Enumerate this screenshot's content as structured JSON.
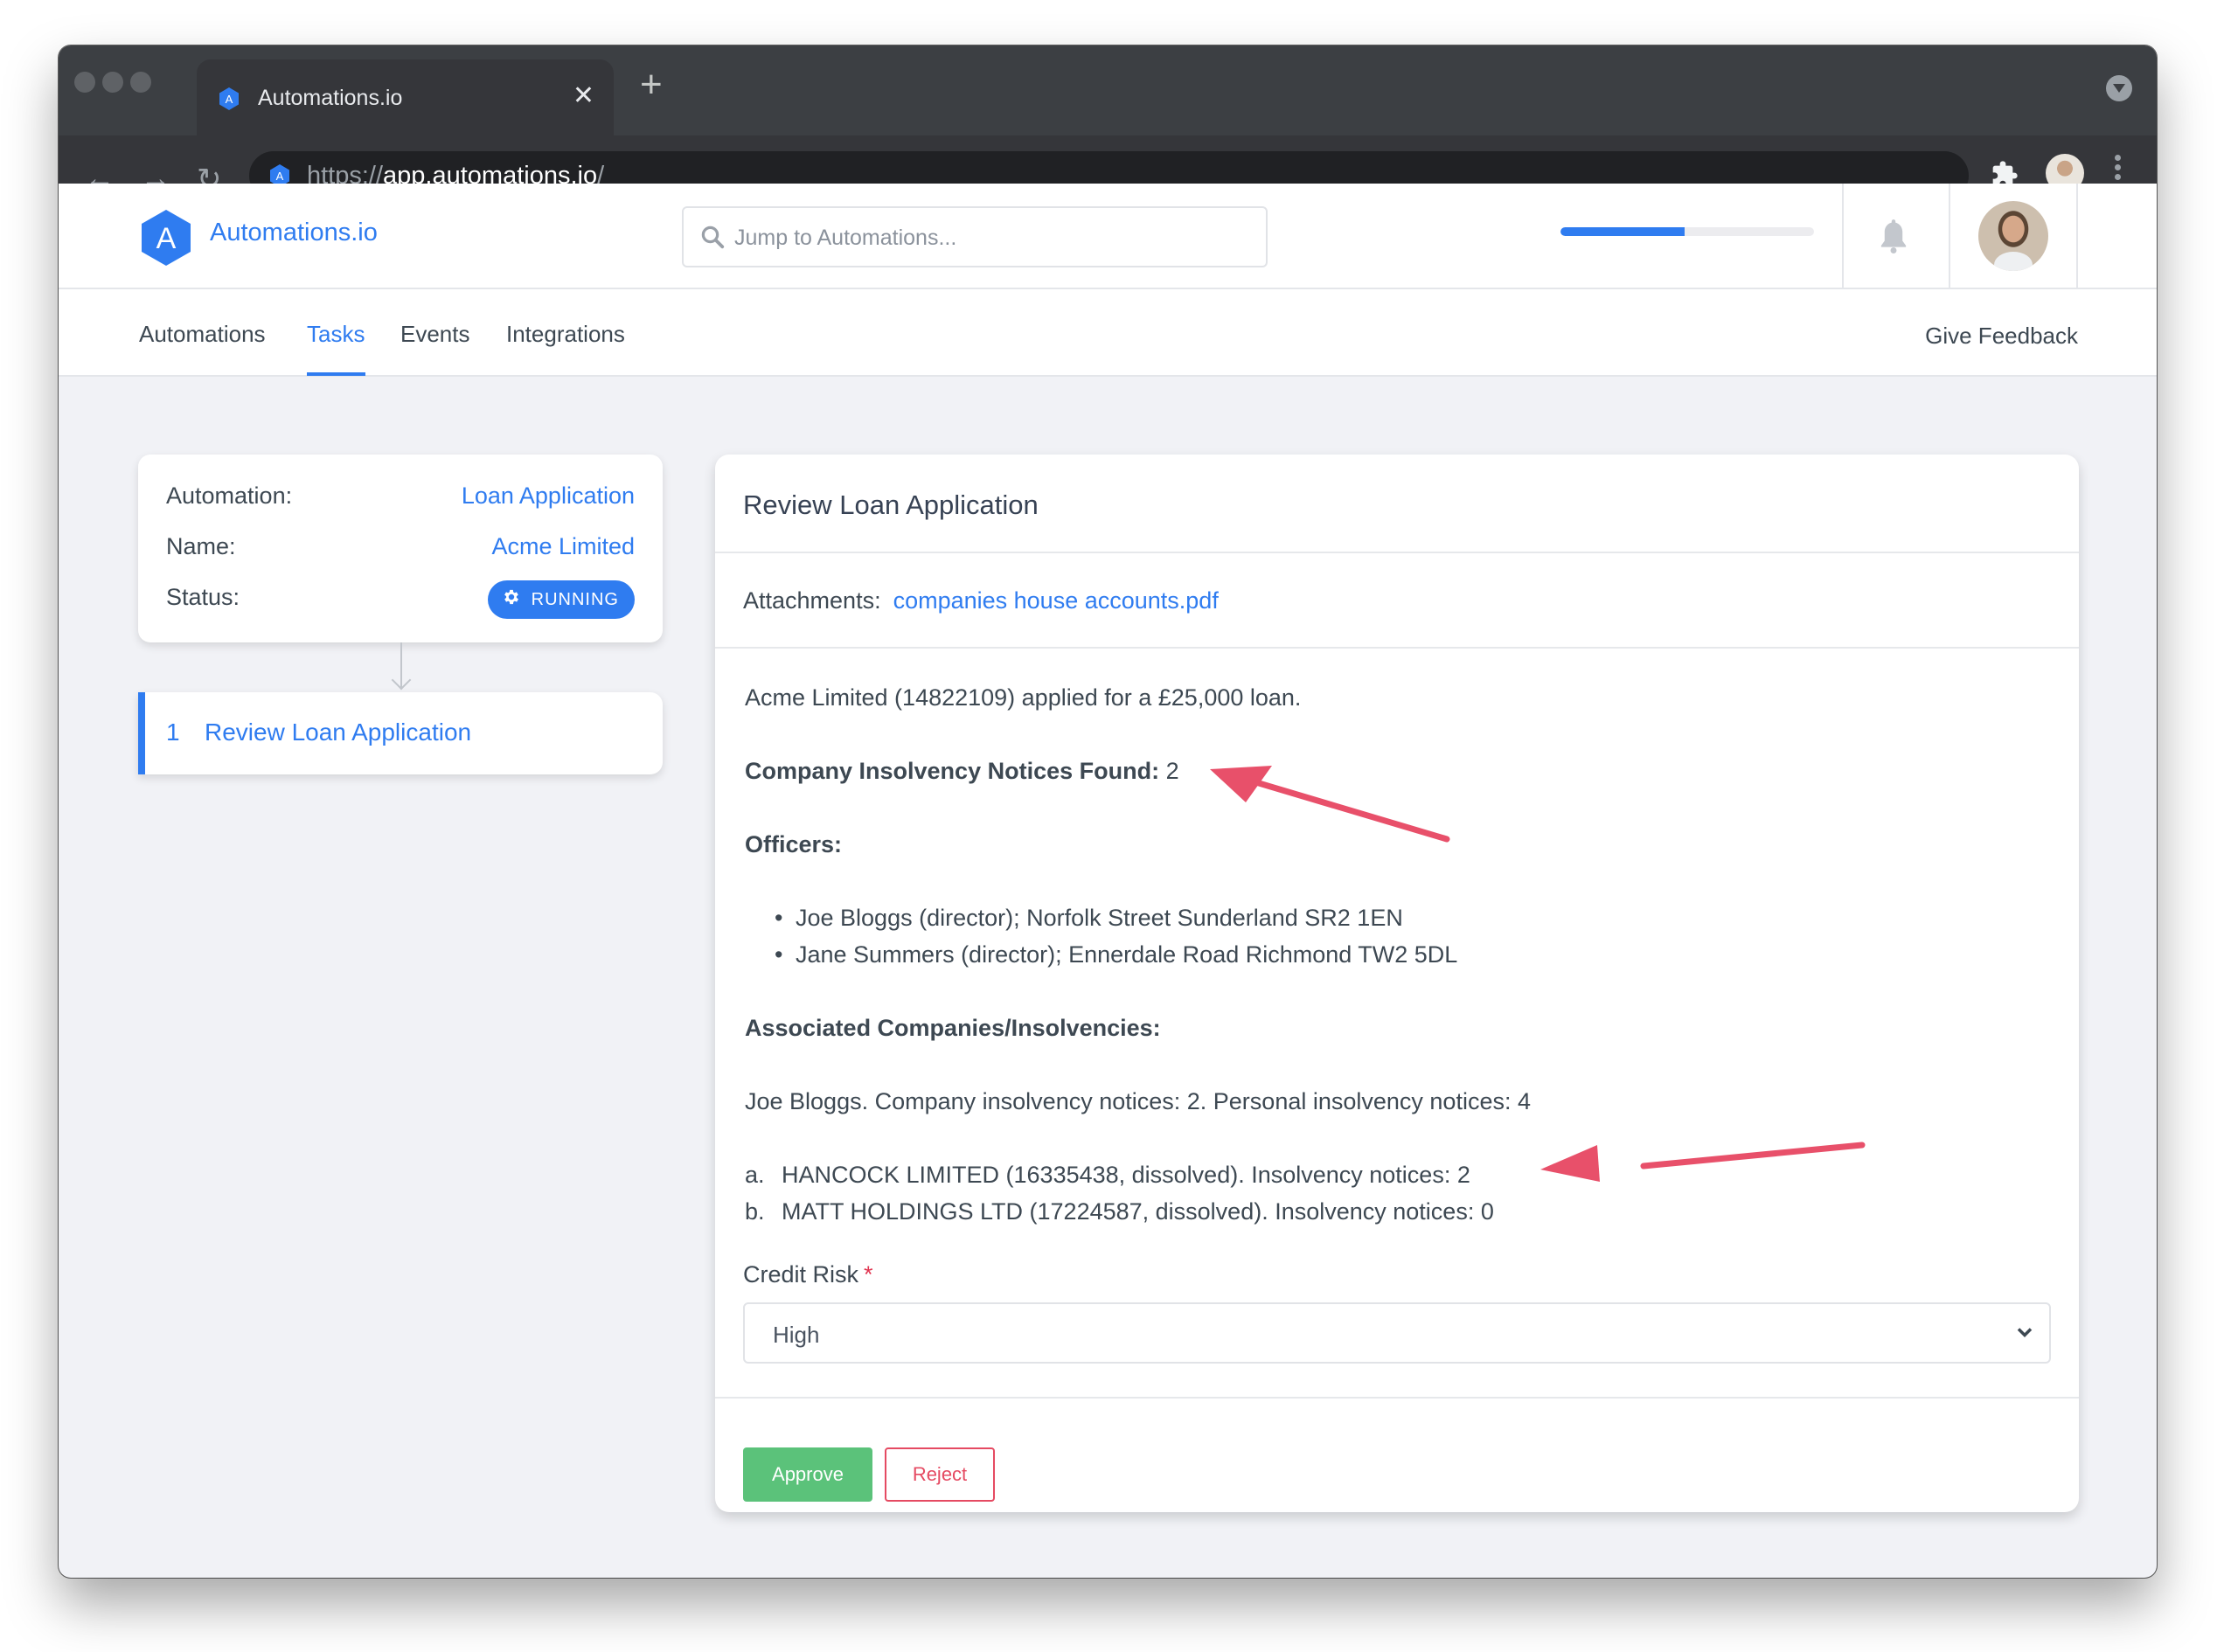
{
  "browser": {
    "tab_title": "Automations.io",
    "url_scheme": "https://",
    "url_host": "app.automations.io",
    "url_path": "/",
    "new_tab_glyph": "+",
    "close_tab_glyph": "✕",
    "back_glyph": "←",
    "forward_glyph": "→",
    "reload_glyph": "↻",
    "extensions_glyph": "✚"
  },
  "header": {
    "brand": "Automations.io",
    "logo_letter": "A",
    "search_placeholder": "Jump to Automations...",
    "search_value": "",
    "progress_fraction": 0.49,
    "accent_color": "#2f7cf0"
  },
  "nav": {
    "items": [
      {
        "label": "Automations",
        "active": false
      },
      {
        "label": "Tasks",
        "active": true
      },
      {
        "label": "Events",
        "active": false
      },
      {
        "label": "Integrations",
        "active": false
      }
    ],
    "feedback": "Give Feedback"
  },
  "summary": {
    "automation_label": "Automation:",
    "automation_value": "Loan Application",
    "name_label": "Name:",
    "name_value": "Acme Limited",
    "status_label": "Status:",
    "status_value": "RUNNING"
  },
  "steps": [
    {
      "number": "1",
      "label": "Review Loan Application"
    }
  ],
  "task": {
    "title": "Review Loan Application",
    "attachments_label": "Attachments:",
    "attachment_file": "companies house accounts.pdf",
    "intro": "Acme Limited (14822109) applied for a £25,000 loan.",
    "insolvency_label": "Company Insolvency Notices Found:",
    "insolvency_value": "2",
    "officers_heading": "Officers:",
    "officers": [
      "Joe Bloggs (director); Norfolk Street Sunderland SR2 1EN",
      "Jane Summers (director); Ennerdale Road Richmond TW2 5DL"
    ],
    "associated_heading": "Associated Companies/Insolvencies:",
    "associated_summary": "Joe Bloggs. Company insolvency notices: 2. Personal insolvency notices: 4",
    "associated_companies": [
      {
        "marker": "a.",
        "text": "HANCOCK LIMITED (16335438, dissolved). Insolvency notices: 2"
      },
      {
        "marker": "b.",
        "text": "MATT HOLDINGS LTD (17224587, dissolved). Insolvency notices: 0"
      }
    ],
    "credit_risk_label": "Credit Risk",
    "required_mark": "*",
    "credit_risk_value": "High",
    "approve_label": "Approve",
    "reject_label": "Reject",
    "approve_color": "#5bc27a",
    "reject_color": "#e54a62"
  },
  "annotations": {
    "arrow_color": "#e8506a"
  }
}
